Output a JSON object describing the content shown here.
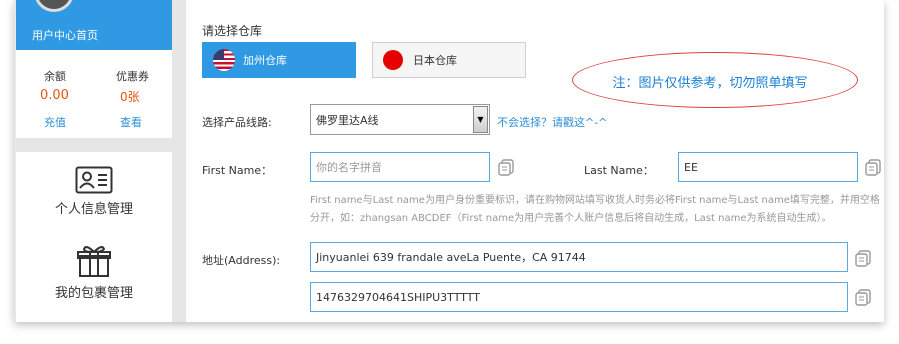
{
  "sidebar": {
    "home_label": "用户中心首页",
    "balance_label": "余额",
    "balance_value": "0.00",
    "balance_action": "充值",
    "coupon_label": "优惠券",
    "coupon_value": "0张",
    "coupon_action": "查看",
    "menu": [
      {
        "label": "个人信息管理",
        "icon": "id-card-icon"
      },
      {
        "label": "我的包裹管理",
        "icon": "gift-package-icon"
      }
    ]
  },
  "main": {
    "warehouse_title": "请选择仓库",
    "warehouses": [
      {
        "label": "加州仓库",
        "icon": "us-flag-icon",
        "selected": true
      },
      {
        "label": "日本仓库",
        "icon": "japan-flag-icon",
        "selected": false
      }
    ],
    "note": "注：图片仅供参考，切勿照单填写",
    "route_label": "选择产品线路:",
    "route_value": "佛罗里达A线",
    "route_help": "不会选择？请戳这^-^",
    "first_name_label": "First Name：",
    "first_name_placeholder": "你的名字拼音",
    "last_name_label": "Last Name：",
    "last_name_value": "EE",
    "name_hint": "First name与Last name为用户身份重要标识，请在购物网站填写收货人时务必将First name与Last name填写完整，并用空格分开，如：zhangsan ABCDEF（First name为用户完善个人账户信息后将自动生成，Last name为系统自动生成）。",
    "address_label": "地址(Address):",
    "address_line1": "Jinyuanlei 639 frandale aveLa Puente，CA 91744",
    "address_line2": "1476329704641SHIPU3TTTTT"
  },
  "colors": {
    "accent_blue": "#2f9ae3",
    "balance_orange": "#e8530e",
    "note_red": "#e0403a",
    "note_text": "#1a7fd4"
  }
}
